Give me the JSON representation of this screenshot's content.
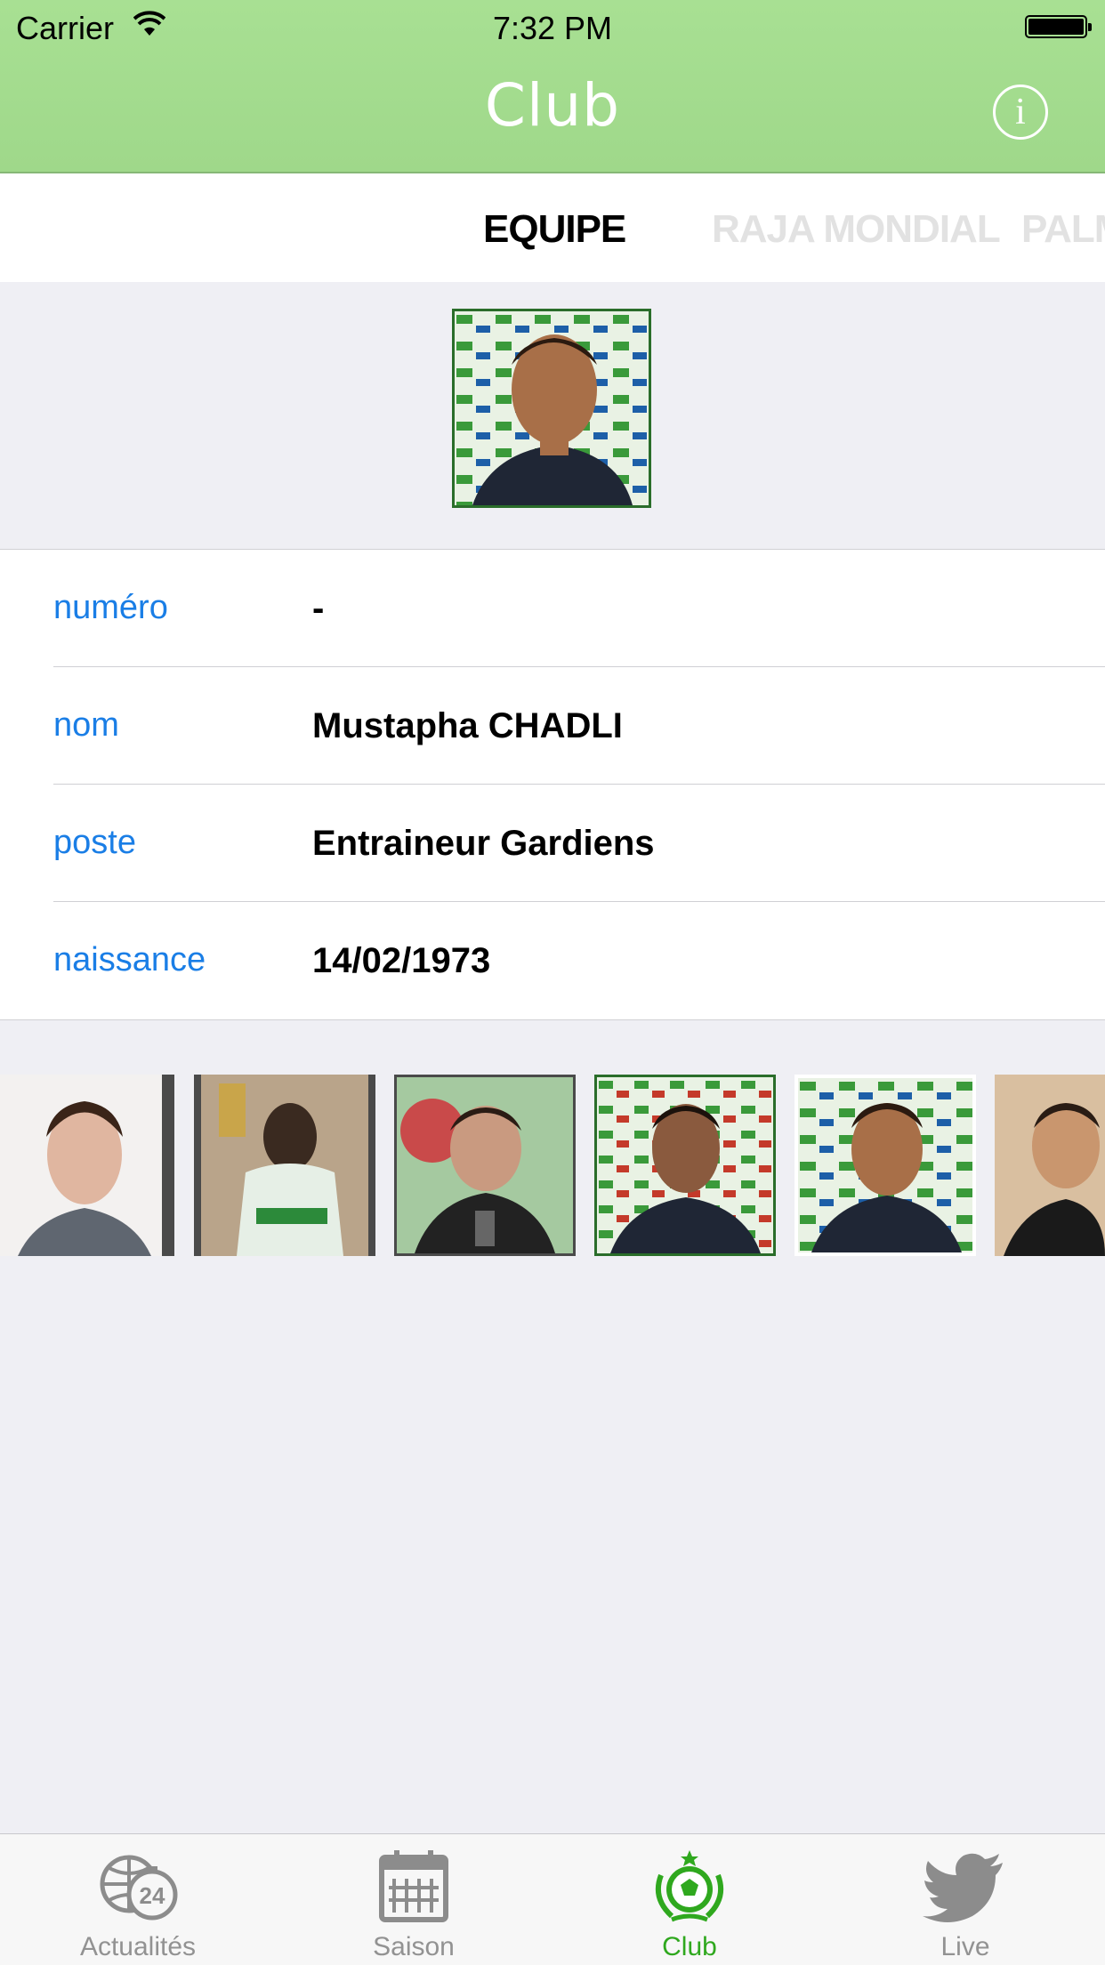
{
  "status_bar": {
    "carrier": "Carrier",
    "time": "7:32 PM"
  },
  "nav": {
    "title": "Club",
    "info_icon": "info-icon"
  },
  "tabs": [
    {
      "label": "EQUIPE",
      "active": true
    },
    {
      "label": "RAJA MONDIAL",
      "active": false
    },
    {
      "label": "PALM",
      "active": false
    }
  ],
  "player": {
    "rows": [
      {
        "label": "numéro",
        "value": "-"
      },
      {
        "label": "nom",
        "value": "Mustapha CHADLI"
      },
      {
        "label": "poste",
        "value": "Entraineur Gardiens"
      },
      {
        "label": "naissance",
        "value": "14/02/1973"
      }
    ]
  },
  "tab_bar": {
    "items": [
      {
        "label": "Actualités",
        "icon": "globe-24-icon"
      },
      {
        "label": "Saison",
        "icon": "calendar-icon"
      },
      {
        "label": "Club",
        "icon": "club-crest-icon",
        "selected": true
      },
      {
        "label": "Live",
        "icon": "twitter-bird-icon"
      }
    ]
  },
  "colors": {
    "accent": "#2fa81e",
    "nav_bg": "#a4de8f",
    "link": "#1a7ee6",
    "tab_inactive": "#929292"
  }
}
